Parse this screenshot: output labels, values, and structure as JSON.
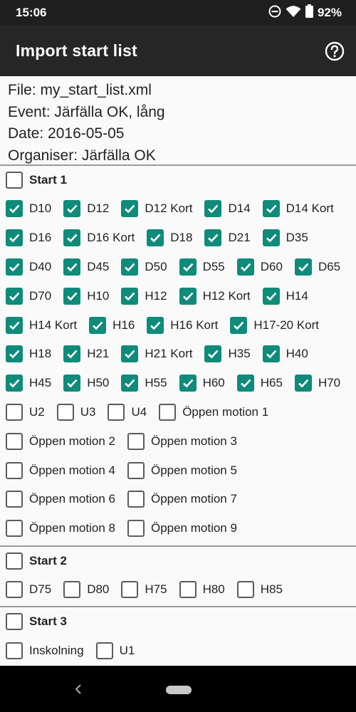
{
  "status": {
    "time": "15:06",
    "battery": "92%"
  },
  "appbar": {
    "title": "Import start list"
  },
  "info": {
    "file": "File: my_start_list.xml",
    "event": "Event: Järfälla OK, lång",
    "date": "Date: 2016-05-05",
    "organiser": "Organiser: Järfälla OK"
  },
  "starts": [
    {
      "label": "Start 1",
      "checked": false,
      "rows": [
        [
          {
            "label": "D10",
            "checked": true
          },
          {
            "label": "D12",
            "checked": true
          },
          {
            "label": "D12 Kort",
            "checked": true
          },
          {
            "label": "D14",
            "checked": true
          },
          {
            "label": "D14 Kort",
            "checked": true
          }
        ],
        [
          {
            "label": "D16",
            "checked": true
          },
          {
            "label": "D16 Kort",
            "checked": true
          },
          {
            "label": "D18",
            "checked": true
          },
          {
            "label": "D21",
            "checked": true
          },
          {
            "label": "D35",
            "checked": true
          }
        ],
        [
          {
            "label": "D40",
            "checked": true
          },
          {
            "label": "D45",
            "checked": true
          },
          {
            "label": "D50",
            "checked": true
          },
          {
            "label": "D55",
            "checked": true
          },
          {
            "label": "D60",
            "checked": true
          },
          {
            "label": "D65",
            "checked": true
          }
        ],
        [
          {
            "label": "D70",
            "checked": true
          },
          {
            "label": "H10",
            "checked": true
          },
          {
            "label": "H12",
            "checked": true
          },
          {
            "label": "H12 Kort",
            "checked": true
          },
          {
            "label": "H14",
            "checked": true
          }
        ],
        [
          {
            "label": "H14 Kort",
            "checked": true
          },
          {
            "label": "H16",
            "checked": true
          },
          {
            "label": "H16 Kort",
            "checked": true
          },
          {
            "label": "H17-20 Kort",
            "checked": true
          }
        ],
        [
          {
            "label": "H18",
            "checked": true
          },
          {
            "label": "H21",
            "checked": true
          },
          {
            "label": "H21 Kort",
            "checked": true
          },
          {
            "label": "H35",
            "checked": true
          },
          {
            "label": "H40",
            "checked": true
          }
        ],
        [
          {
            "label": "H45",
            "checked": true
          },
          {
            "label": "H50",
            "checked": true
          },
          {
            "label": "H55",
            "checked": true
          },
          {
            "label": "H60",
            "checked": true
          },
          {
            "label": "H65",
            "checked": true
          },
          {
            "label": "H70",
            "checked": true
          }
        ],
        [
          {
            "label": "U2",
            "checked": false
          },
          {
            "label": "U3",
            "checked": false
          },
          {
            "label": "U4",
            "checked": false
          },
          {
            "label": "Öppen motion 1",
            "checked": false
          }
        ],
        [
          {
            "label": "Öppen motion 2",
            "checked": false
          },
          {
            "label": "Öppen motion 3",
            "checked": false
          }
        ],
        [
          {
            "label": "Öppen motion 4",
            "checked": false
          },
          {
            "label": "Öppen motion 5",
            "checked": false
          }
        ],
        [
          {
            "label": "Öppen motion 6",
            "checked": false
          },
          {
            "label": "Öppen motion 7",
            "checked": false
          }
        ],
        [
          {
            "label": "Öppen motion 8",
            "checked": false
          },
          {
            "label": "Öppen motion 9",
            "checked": false
          }
        ]
      ]
    },
    {
      "label": "Start 2",
      "checked": false,
      "rows": [
        [
          {
            "label": "D75",
            "checked": false
          },
          {
            "label": "D80",
            "checked": false
          },
          {
            "label": "H75",
            "checked": false
          },
          {
            "label": "H80",
            "checked": false
          },
          {
            "label": "H85",
            "checked": false
          }
        ]
      ]
    },
    {
      "label": "Start 3",
      "checked": false,
      "rows": [
        [
          {
            "label": "Inskolning",
            "checked": false
          },
          {
            "label": "U1",
            "checked": false
          }
        ]
      ]
    }
  ],
  "colors": {
    "accent": "#0e8b7a",
    "appbar": "#262626",
    "statusbar": "#1f1f1f"
  },
  "icons": {
    "help": "help-circle-icon",
    "back": "back-chevron-icon",
    "home": "home-pill-icon"
  }
}
